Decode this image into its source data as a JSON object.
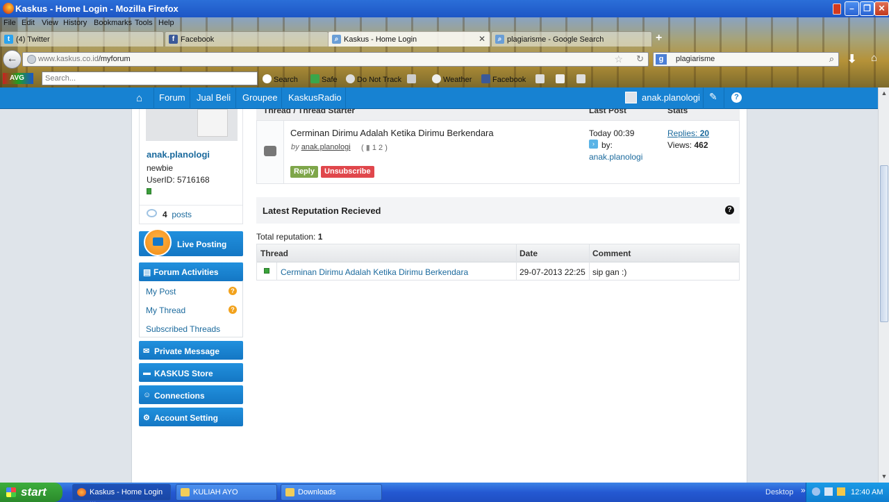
{
  "window": {
    "title": "Kaskus - Home Login - Mozilla Firefox"
  },
  "menu": [
    "File",
    "Edit",
    "View",
    "History",
    "Bookmarks",
    "Tools",
    "Help"
  ],
  "tabs": [
    {
      "label": "(4) Twitter",
      "icon": "twitter-icon"
    },
    {
      "label": "Facebook",
      "icon": "facebook-icon"
    },
    {
      "label": "Kaskus - Home Login",
      "icon": "search-icon",
      "active": true
    },
    {
      "label": "plagiarisme - Google Search",
      "icon": "search-icon"
    }
  ],
  "address": {
    "host": "www.kaskus.co.id",
    "path": "/myforum"
  },
  "search_box": {
    "value": "plagiarisme"
  },
  "toolbar": {
    "search_placeholder": "Search...",
    "search_label": "Search",
    "safe": "Safe",
    "dnt": "Do Not Track",
    "weather": "Weather",
    "facebook": "Facebook"
  },
  "kaskus_nav": {
    "items": [
      "Forum",
      "Jual Beli",
      "Groupee",
      "KaskusRadio"
    ],
    "username": "anak.planologi"
  },
  "profile": {
    "name": "anak.planologi",
    "rank": "newbie",
    "userid": "UserID: 5716168",
    "posts_count": "4",
    "posts_label": "posts"
  },
  "sidebar": {
    "live_posting": "Live Posting",
    "forum_activities": "Forum Activities",
    "my_post": "My Post",
    "my_thread": "My Thread",
    "subscribed_threads": "Subscribed Threads",
    "private_message": "Private Message",
    "kaskus_store": "KASKUS Store",
    "connections": "Connections",
    "account_setting": "Account Setting"
  },
  "thread_table": {
    "headers": [
      "Thread / Thread Starter",
      "Last Post",
      "Stats"
    ],
    "thread": {
      "title": "Cerminan Dirimu Adalah Ketika Dirimu Berkendara",
      "by": "by",
      "starter": "anak.planologi",
      "pages": "1  2",
      "reply": "Reply",
      "unsubscribe": "Unsubscribe",
      "last_post_time": "Today 00:39",
      "last_post_by": "by:",
      "last_post_user": "anak.planologi",
      "replies_label": "Replies:",
      "replies": "20",
      "views_label": "Views:",
      "views": "462"
    }
  },
  "reputation": {
    "title": "Latest Reputation Recieved",
    "total_label": "Total reputation:",
    "total": "1",
    "columns": [
      "Thread",
      "Date",
      "Comment"
    ],
    "rows": [
      {
        "thread": "Cerminan Dirimu Adalah Ketika Dirimu Berkendara",
        "date": "29-07-2013 22:25",
        "comment": "sip gan :)"
      }
    ]
  },
  "taskbar": {
    "start": "start",
    "buttons": [
      "Kaskus - Home Login ...",
      "KULIAH AYO",
      "Downloads"
    ],
    "desktop": "Desktop",
    "clock": "12:40 AM"
  }
}
